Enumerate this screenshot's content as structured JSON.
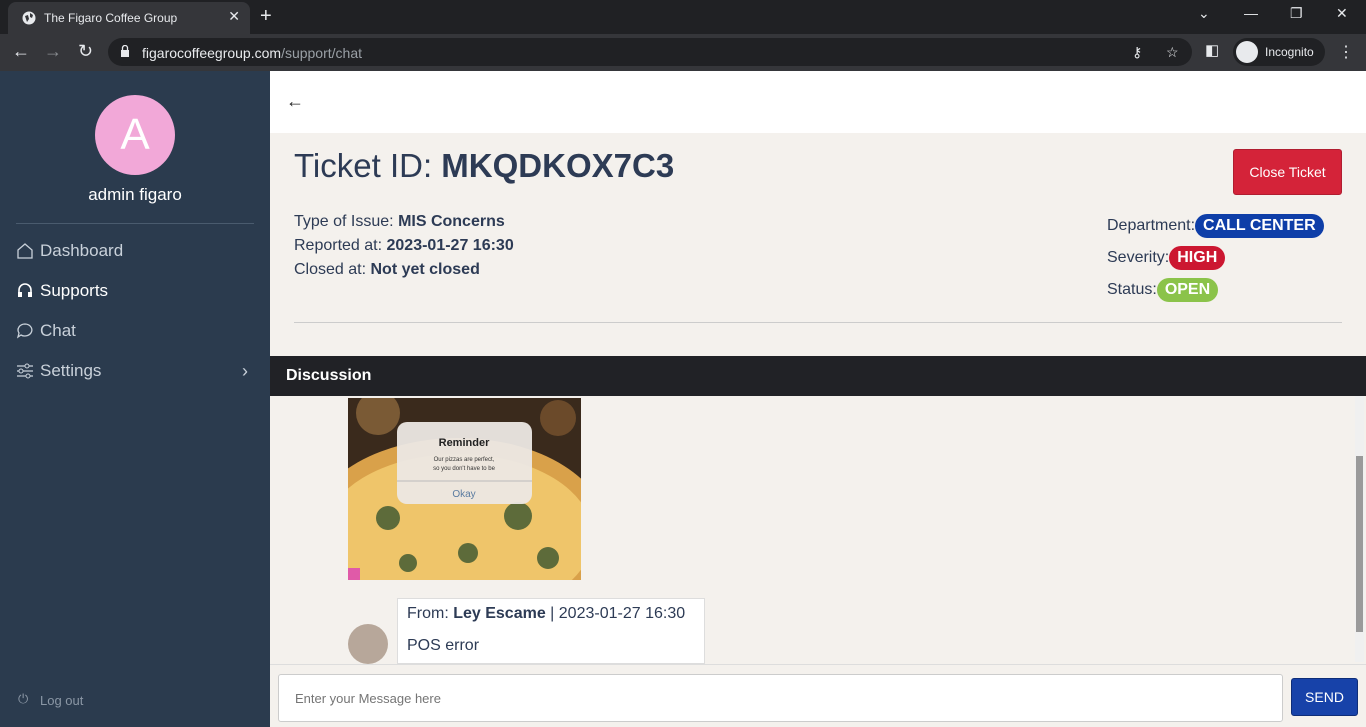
{
  "browser": {
    "tab_title": "The Figaro Coffee Group",
    "url_host": "figarocoffeegroup.com",
    "url_path": "/support/chat",
    "profile_label": "Incognito"
  },
  "sidebar": {
    "avatar_initial": "A",
    "username": "admin figaro",
    "items": [
      {
        "label": "Dashboard",
        "icon": "home-icon"
      },
      {
        "label": "Supports",
        "icon": "headset-icon"
      },
      {
        "label": "Chat",
        "icon": "chat-bubble-icon"
      },
      {
        "label": "Settings",
        "icon": "sliders-icon"
      }
    ],
    "logout_label": "Log out"
  },
  "ticket": {
    "title_prefix": "Ticket ID: ",
    "id": "MKQDKOX7C3",
    "close_label": "Close Ticket",
    "type_label": "Type of Issue: ",
    "type_value": "MIS Concerns",
    "reported_label": "Reported at: ",
    "reported_value": "2023-01-27 16:30",
    "closed_label": "Closed at: ",
    "closed_value": "Not yet closed",
    "department_label": "Department:",
    "department_value": "CALL CENTER",
    "severity_label": "Severity:",
    "severity_value": "HIGH",
    "status_label": "Status:",
    "status_value": "OPEN"
  },
  "colors": {
    "department_badge": "#0e3ea8",
    "severity_badge": "#cc1731",
    "status_badge": "#8bc34a"
  },
  "discussion": {
    "header": "Discussion",
    "image": {
      "title": "Reminder",
      "line1": "Our pizzas are perfect,",
      "line2": "so you don't have to be",
      "button": "Okay"
    },
    "message": {
      "from_label": "From: ",
      "from_name": "Ley Escame",
      "sep_time": " | 2023-01-27 16:30",
      "text": "POS error"
    }
  },
  "composer": {
    "placeholder": "Enter your Message here",
    "send_label": "SEND"
  }
}
